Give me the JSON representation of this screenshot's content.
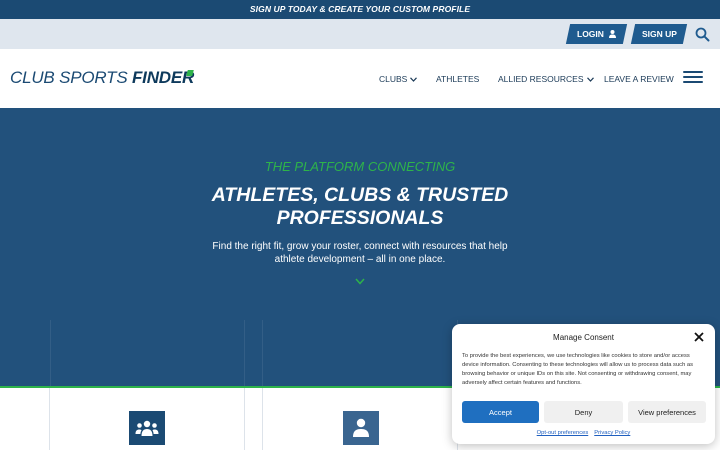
{
  "promo": {
    "text": "SIGN UP TODAY & CREATE YOUR CUSTOM PROFILE"
  },
  "utility": {
    "login_label": "LOGIN",
    "signup_label": "SIGN UP",
    "login_icon": "user-icon",
    "search_icon": "search-icon"
  },
  "header": {
    "logo_regular": "CLUB SPORTS ",
    "logo_bold": "FINDER",
    "nav": {
      "clubs": "CLUBS",
      "athletes": "ATHLETES",
      "allied": "ALLIED RESOURCES",
      "review": "LEAVE A REVIEW"
    },
    "menu_icon": "hamburger-menu-icon"
  },
  "hero": {
    "kicker": "THE PLATFORM CONNECTING",
    "title_line1": "ATHLETES, CLUBS & TRUSTED",
    "title_line2": "PROFESSIONALS",
    "subtitle": "Find the right fit, grow your roster, connect with resources that help athlete development – all in one place.",
    "scroll_icon": "chevron-down-icon"
  },
  "cards": [
    {
      "icon": "group-icon"
    },
    {
      "icon": "person-icon"
    }
  ],
  "consent": {
    "title": "Manage Consent",
    "body": "To provide the best experiences, we use technologies like cookies to store and/or access device information. Consenting to these technologies will allow us to process data such as browsing behavior or unique IDs on this site. Not consenting or withdrawing consent, may adversely affect certain features and functions.",
    "accept_label": "Accept",
    "deny_label": "Deny",
    "prefs_label": "View preferences",
    "optout_link": "Opt-out preferences",
    "privacy_link": "Privacy Policy"
  },
  "colors": {
    "navy": "#1b4a73",
    "hero_blue": "#22517c",
    "green": "#2eb34a",
    "accept_blue": "#1f6fc0"
  }
}
